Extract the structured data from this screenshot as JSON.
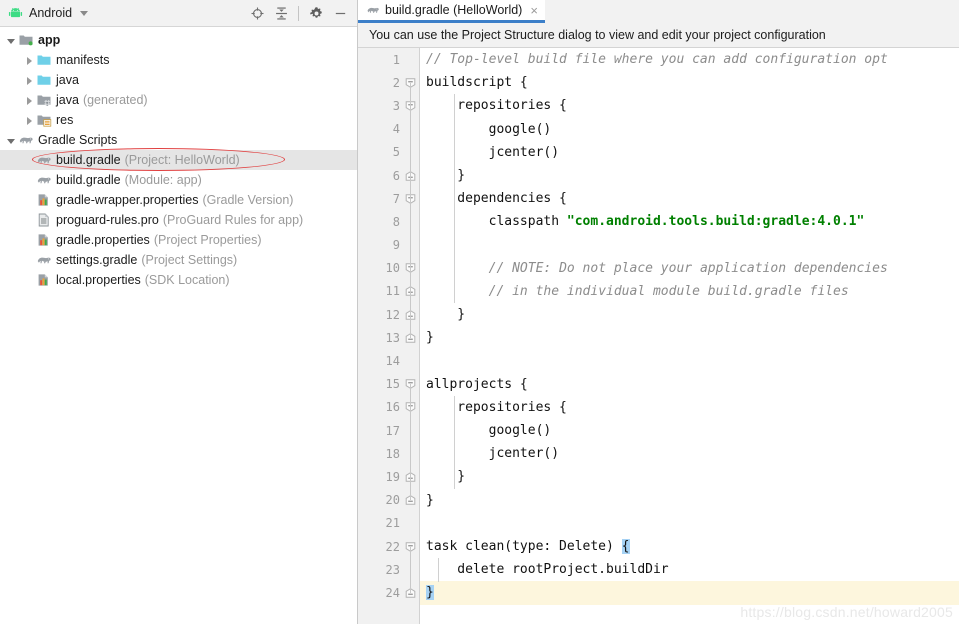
{
  "sidebar": {
    "view_name": "Android",
    "android_icon": "android-robot-icon",
    "toolbar": [
      {
        "name": "select-opened-file-icon",
        "label": "Select Opened File"
      },
      {
        "name": "collapse-all-icon",
        "label": "Collapse All"
      },
      {
        "name": "gear-icon",
        "label": "Settings"
      },
      {
        "name": "hide-icon",
        "label": "Hide"
      }
    ],
    "tree": [
      {
        "depth": 0,
        "twisty": "open",
        "icon": "folder-module-icon",
        "label": "app",
        "sub": "",
        "bold": true,
        "selected": false
      },
      {
        "depth": 1,
        "twisty": "closed",
        "icon": "folder-blue-icon",
        "label": "manifests",
        "sub": "",
        "bold": false,
        "selected": false
      },
      {
        "depth": 1,
        "twisty": "closed",
        "icon": "folder-blue-icon",
        "label": "java",
        "sub": "",
        "bold": false,
        "selected": false
      },
      {
        "depth": 1,
        "twisty": "closed",
        "icon": "folder-generated-icon",
        "label": "java",
        "sub": "(generated)",
        "bold": false,
        "selected": false
      },
      {
        "depth": 1,
        "twisty": "closed",
        "icon": "folder-res-icon",
        "label": "res",
        "sub": "",
        "bold": false,
        "selected": false
      },
      {
        "depth": 0,
        "twisty": "open",
        "icon": "gradle-elephant-icon",
        "label": "Gradle Scripts",
        "sub": "",
        "bold": false,
        "selected": false
      },
      {
        "depth": 1,
        "twisty": "none",
        "icon": "gradle-elephant-icon",
        "label": "build.gradle",
        "sub": "(Project: HelloWorld)",
        "bold": false,
        "selected": true
      },
      {
        "depth": 1,
        "twisty": "none",
        "icon": "gradle-elephant-icon",
        "label": "build.gradle",
        "sub": "(Module: app)",
        "bold": false,
        "selected": false
      },
      {
        "depth": 1,
        "twisty": "none",
        "icon": "properties-file-icon",
        "label": "gradle-wrapper.properties",
        "sub": "(Gradle Version)",
        "bold": false,
        "selected": false
      },
      {
        "depth": 1,
        "twisty": "none",
        "icon": "text-file-icon",
        "label": "proguard-rules.pro",
        "sub": "(ProGuard Rules for app)",
        "bold": false,
        "selected": false
      },
      {
        "depth": 1,
        "twisty": "none",
        "icon": "properties-file-icon",
        "label": "gradle.properties",
        "sub": "(Project Properties)",
        "bold": false,
        "selected": false
      },
      {
        "depth": 1,
        "twisty": "none",
        "icon": "gradle-elephant-icon",
        "label": "settings.gradle",
        "sub": "(Project Settings)",
        "bold": false,
        "selected": false
      },
      {
        "depth": 1,
        "twisty": "none",
        "icon": "properties-file-icon",
        "label": "local.properties",
        "sub": "(SDK Location)",
        "bold": false,
        "selected": false
      }
    ],
    "annotation": {
      "shape": "red-ellipse",
      "color": "#e04040",
      "targets": "build.gradle (Project: HelloWorld)"
    }
  },
  "editor": {
    "tab": {
      "icon": "gradle-elephant-icon",
      "title": "build.gradle (HelloWorld)",
      "close": "×",
      "active_color": "#3c7fc9"
    },
    "notification": "You can use the Project Structure dialog to view and edit your project configuration",
    "current_line": 24,
    "lines": [
      {
        "n": 1,
        "fold": "none",
        "segments": [
          {
            "t": "comment",
            "v": "// Top-level build file where you can add configuration opt"
          }
        ]
      },
      {
        "n": 2,
        "fold": "start",
        "segments": [
          {
            "t": "plain",
            "v": "buildscript {"
          }
        ]
      },
      {
        "n": 3,
        "fold": "start",
        "segments": [
          {
            "t": "plain",
            "v": "    repositories {"
          }
        ]
      },
      {
        "n": 4,
        "fold": "none",
        "segments": [
          {
            "t": "plain",
            "v": "        google()"
          }
        ]
      },
      {
        "n": 5,
        "fold": "none",
        "segments": [
          {
            "t": "plain",
            "v": "        jcenter()"
          }
        ]
      },
      {
        "n": 6,
        "fold": "end",
        "segments": [
          {
            "t": "plain",
            "v": "    }"
          }
        ]
      },
      {
        "n": 7,
        "fold": "start",
        "segments": [
          {
            "t": "plain",
            "v": "    dependencies {"
          }
        ]
      },
      {
        "n": 8,
        "fold": "none",
        "segments": [
          {
            "t": "plain",
            "v": "        classpath "
          },
          {
            "t": "string",
            "v": "\"com.android.tools.build:gradle:4.0.1\""
          }
        ]
      },
      {
        "n": 9,
        "fold": "none",
        "segments": [
          {
            "t": "plain",
            "v": ""
          }
        ]
      },
      {
        "n": 10,
        "fold": "start",
        "segments": [
          {
            "t": "plain",
            "v": "        "
          },
          {
            "t": "comment",
            "v": "// NOTE: Do not place your application dependencies"
          }
        ]
      },
      {
        "n": 11,
        "fold": "end",
        "segments": [
          {
            "t": "plain",
            "v": "        "
          },
          {
            "t": "comment",
            "v": "// in the individual module build.gradle files"
          }
        ]
      },
      {
        "n": 12,
        "fold": "end",
        "segments": [
          {
            "t": "plain",
            "v": "    }"
          }
        ]
      },
      {
        "n": 13,
        "fold": "end",
        "segments": [
          {
            "t": "plain",
            "v": "}"
          }
        ]
      },
      {
        "n": 14,
        "fold": "none",
        "segments": [
          {
            "t": "plain",
            "v": ""
          }
        ]
      },
      {
        "n": 15,
        "fold": "start",
        "segments": [
          {
            "t": "plain",
            "v": "allprojects {"
          }
        ]
      },
      {
        "n": 16,
        "fold": "start",
        "segments": [
          {
            "t": "plain",
            "v": "    repositories {"
          }
        ]
      },
      {
        "n": 17,
        "fold": "none",
        "segments": [
          {
            "t": "plain",
            "v": "        google()"
          }
        ]
      },
      {
        "n": 18,
        "fold": "none",
        "segments": [
          {
            "t": "plain",
            "v": "        jcenter()"
          }
        ]
      },
      {
        "n": 19,
        "fold": "end",
        "segments": [
          {
            "t": "plain",
            "v": "    }"
          }
        ]
      },
      {
        "n": 20,
        "fold": "end",
        "segments": [
          {
            "t": "plain",
            "v": "}"
          }
        ]
      },
      {
        "n": 21,
        "fold": "none",
        "segments": [
          {
            "t": "plain",
            "v": ""
          }
        ]
      },
      {
        "n": 22,
        "fold": "start",
        "segments": [
          {
            "t": "plain",
            "v": "task clean(type: Delete) "
          },
          {
            "t": "brace",
            "v": "{"
          }
        ]
      },
      {
        "n": 23,
        "fold": "none",
        "segments": [
          {
            "t": "plain",
            "v": "    delete rootProject.buildDir"
          }
        ]
      },
      {
        "n": 24,
        "fold": "end",
        "segments": [
          {
            "t": "brace",
            "v": "}"
          }
        ]
      }
    ],
    "watermark": "https://blog.csdn.net/howard2005"
  }
}
